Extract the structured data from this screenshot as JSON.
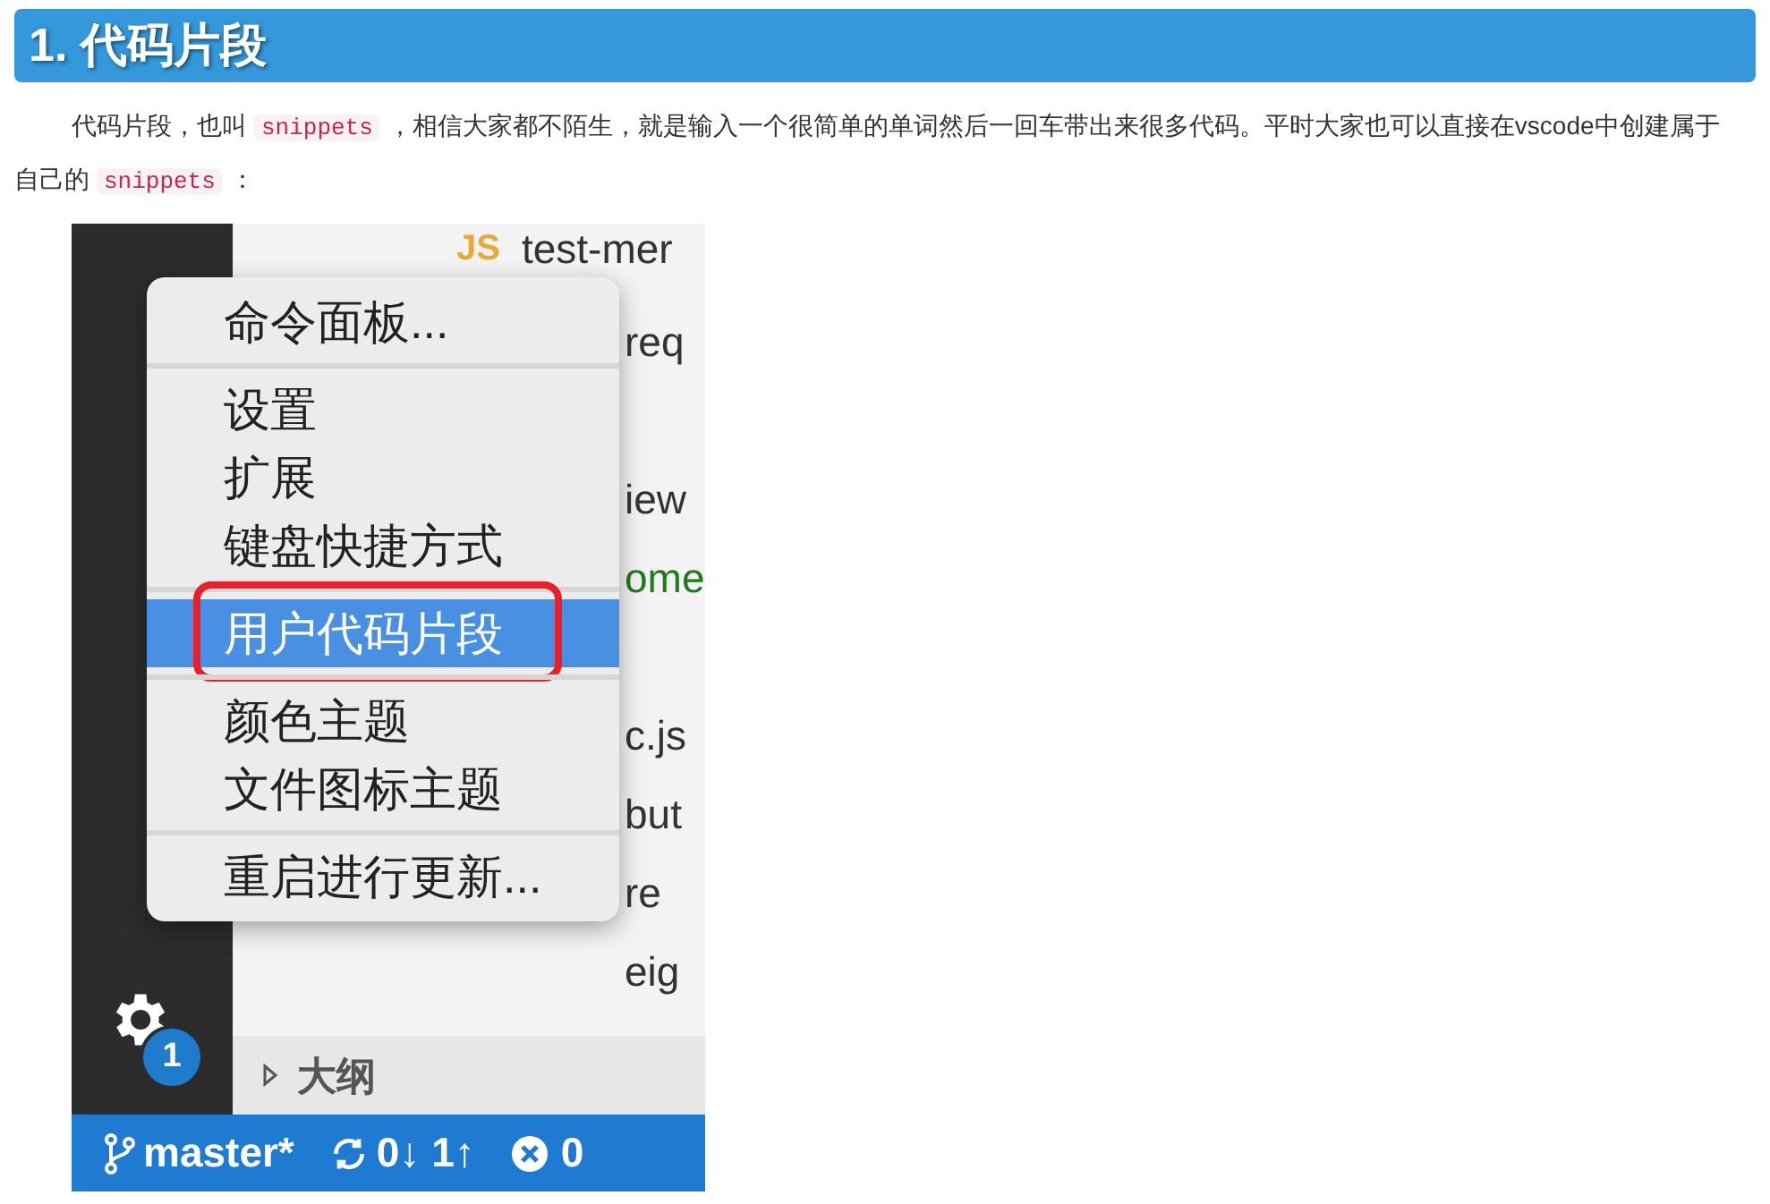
{
  "heading": "1. 代码片段",
  "paragraph": [
    {
      "kind": "text",
      "text": "代码片段，也叫"
    },
    {
      "kind": "code",
      "text": "snippets"
    },
    {
      "kind": "text",
      "text": "，相信大家都不陌生，就是输入一个很简单的单词然后一回车带出来很多代码。平时大家也可以直接在vscode中创建属于自己的"
    },
    {
      "kind": "code",
      "text": "snippets"
    },
    {
      "kind": "text",
      "text": "："
    }
  ],
  "screenshot": {
    "files": [
      {
        "kind": "js",
        "icon_text": "JS",
        "name": "test-mer",
        "color": "#333333"
      },
      {
        "kind": "plain",
        "name": "req",
        "color": "#333333"
      },
      {
        "kind": "plain",
        "name": "iew",
        "color": "#333333"
      },
      {
        "kind": "plain",
        "name": "ome",
        "color": "#237a1e"
      },
      {
        "kind": "plain",
        "name": "c.js",
        "color": "#333333"
      },
      {
        "kind": "plain",
        "name": "but",
        "color": "#333333"
      },
      {
        "kind": "plain",
        "name": "re",
        "color": "#333333"
      },
      {
        "kind": "plain",
        "name": "eig",
        "color": "#333333"
      }
    ],
    "menu": [
      [
        {
          "label": "命令面板...",
          "selected": false,
          "outlined": false
        }
      ],
      [
        {
          "label": "设置",
          "selected": false,
          "outlined": false
        },
        {
          "label": "扩展",
          "selected": false,
          "outlined": false
        },
        {
          "label": "键盘快捷方式",
          "selected": false,
          "outlined": false
        }
      ],
      [
        {
          "label": "用户代码片段",
          "selected": true,
          "outlined": true
        }
      ],
      [
        {
          "label": "颜色主题",
          "selected": false,
          "outlined": false
        },
        {
          "label": "文件图标主题",
          "selected": false,
          "outlined": false
        }
      ],
      [
        {
          "label": "重启进行更新...",
          "selected": false,
          "outlined": false
        }
      ]
    ],
    "badge": "1",
    "outline": {
      "label": "大纲",
      "expanded": false
    },
    "status": {
      "branch": "master*",
      "sync": "0↓ 1↑",
      "errors": "0"
    }
  }
}
